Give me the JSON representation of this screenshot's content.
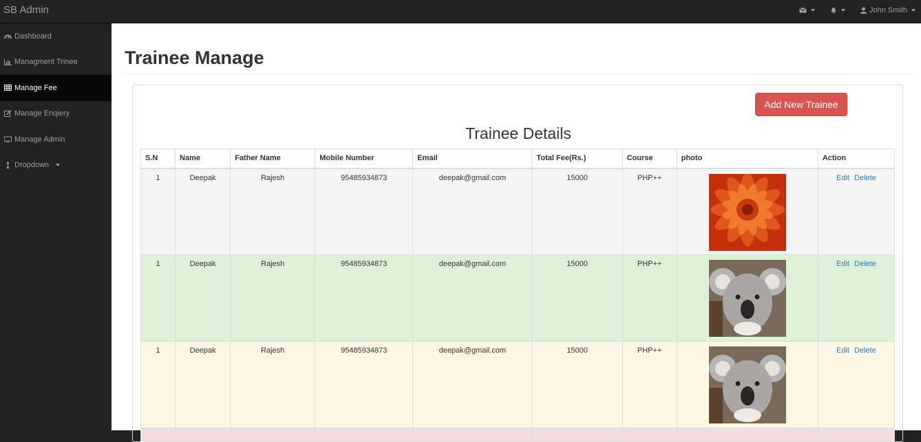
{
  "app": {
    "brand": "SB Admin"
  },
  "topbar": {
    "user_name": "John Smith",
    "icons": [
      "envelope-icon",
      "bell-icon",
      "user-icon"
    ]
  },
  "sidebar": {
    "items": [
      {
        "label": "Dashboard",
        "icon": "dashboard-icon"
      },
      {
        "label": "Managment Trinee",
        "icon": "bar-chart-icon"
      },
      {
        "label": "Manage Fee",
        "icon": "table-icon",
        "active": true
      },
      {
        "label": "Manage Enqiery",
        "icon": "edit-icon"
      },
      {
        "label": "Manage Admin",
        "icon": "desktop-icon"
      },
      {
        "label": "Dropdown",
        "icon": "arrows-v-icon"
      }
    ]
  },
  "page": {
    "title": "Trainee Manage",
    "add_button": "Add New Trainee",
    "table_title": "Trainee Details"
  },
  "table": {
    "headers": [
      "S.N",
      "Name",
      "Father Name",
      "Mobile Number",
      "Email",
      "Total Fee(Rs.)",
      "Course",
      "photo",
      "Action"
    ],
    "rows": [
      {
        "sn": "1",
        "name": "Deepak",
        "father": "Rajesh",
        "mobile": "95485934873",
        "email": "deepak@gmail.com",
        "fee": "15000",
        "course": "PHP++",
        "photo": "flower-image",
        "edit": "Edit",
        "delete": "Delete"
      },
      {
        "sn": "1",
        "name": "Deepak",
        "father": "Rajesh",
        "mobile": "95485934873",
        "email": "deepak@gmail.com",
        "fee": "15000",
        "course": "PHP++",
        "photo": "koala-image",
        "edit": "Edit",
        "delete": "Delete"
      },
      {
        "sn": "1",
        "name": "Deepak",
        "father": "Rajesh",
        "mobile": "95485934873",
        "email": "deepak@gmail.com",
        "fee": "15000",
        "course": "PHP++",
        "photo": "koala-image",
        "edit": "Edit",
        "delete": "Delete"
      }
    ]
  },
  "colors": {
    "sidebar_bg": "#222222",
    "active_bg": "#080808",
    "danger_btn": "#d9534f",
    "link": "#337ab7",
    "row_active": "#f5f5f5",
    "row_success": "#dff0d8",
    "row_warning": "#fcf8e3",
    "row_danger": "#f2dede"
  }
}
